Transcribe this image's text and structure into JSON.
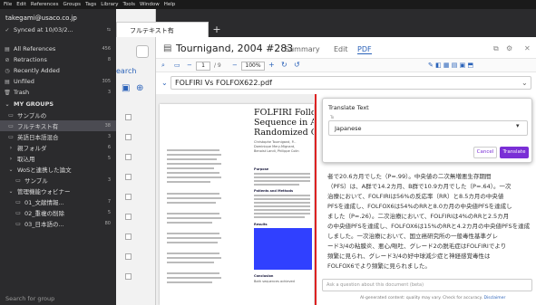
{
  "menubar": [
    "File",
    "Edit",
    "References",
    "Groups",
    "Tags",
    "Library",
    "Tools",
    "Window",
    "Help"
  ],
  "sidebar": {
    "account": "takegami@usaco.co.jp",
    "synced": "Synced at 10/03/2...",
    "items": [
      {
        "label": "All References",
        "count": "456",
        "icon": "library-icon"
      },
      {
        "label": "Retractions",
        "count": "8",
        "icon": "retractions-icon"
      },
      {
        "label": "Recently Added",
        "count": "",
        "icon": "clock-icon"
      },
      {
        "label": "Unfiled",
        "count": "305",
        "icon": "unfiled-icon"
      },
      {
        "label": "Trash",
        "count": "3",
        "icon": "trash-icon"
      }
    ],
    "groups_header": "MY GROUPS",
    "groups": [
      {
        "label": "サンプルの",
        "count": "",
        "indent": 1
      },
      {
        "label": "フルテキスト有",
        "count": "38",
        "indent": 1,
        "selected": true
      },
      {
        "label": "英語日本語混合",
        "count": "3",
        "indent": 1
      },
      {
        "label": "親フォルダ",
        "count": "6",
        "indent": 1
      },
      {
        "label": "取込用",
        "count": "5",
        "indent": 1
      },
      {
        "label": "WoSと連携した論文",
        "count": "",
        "indent": 1
      },
      {
        "label": "サンプル",
        "count": "3",
        "indent": 2
      },
      {
        "label": "管理機能ウォビナー",
        "count": "",
        "indent": 1
      },
      {
        "label": "01_文献情報...",
        "count": "7",
        "indent": 2
      },
      {
        "label": "02_重複の削除",
        "count": "5",
        "indent": 2
      },
      {
        "label": "03_日本語の...",
        "count": "80",
        "indent": 2
      }
    ],
    "search_placeholder": "Search for group"
  },
  "tab": {
    "title": "フルテキスト有",
    "plus": "+"
  },
  "middle": {
    "search_label": "earch"
  },
  "reference": {
    "title": "Tournigand, 2004 #283",
    "tabs": [
      "Summary",
      "Edit",
      "PDF"
    ],
    "active_tab": "PDF"
  },
  "toolbar": {
    "page": "1",
    "pages": "/ 9",
    "zoom": "100%"
  },
  "file": {
    "name": "FOLFIRI Vs FOLFOX622.pdf"
  },
  "pdf": {
    "heading": [
      "FOLFIRI Follo",
      "Sequence in Ac",
      "Randomized G"
    ],
    "authors": [
      "Christophe Tournigand, P...",
      "Dominique Mery-Mignard,",
      "Benoist Landi, Philippe Colin"
    ],
    "sections": [
      "Purpose",
      "Patients and Methods",
      "Results",
      "Conclusion"
    ],
    "conclusion_text": "Both sequences achieved"
  },
  "translate": {
    "title": "Translate Text",
    "to_label": "To",
    "language": "Japanese",
    "cancel": "Cancel",
    "submit": "Translate"
  },
  "translated_text": [
    "者で20.6カ月でした（P=.99）。中央値の二次無増悪生存期間",
    "（PFS）は、A群で14.2カ月、B群で10.9カ月でした（P=.64）。一次",
    "治療において、FOLFIRIは56%の反応率（RR）と8.5カ月の中央値",
    "PFSを達成し、FOLFOX6は54%のRRと8.0カ月の中央値PFSを達成し",
    "ました（P=.26）。二次治療において、FOLFIRIは4%のRRと2.5カ月",
    "の中央値PFSを達成し、FOLFOX6は15%のRRと4.2カ月の中央値PFSを達成",
    "しました。一次治療において、国立癌研究所の一般毒性基準グレ",
    "ード3/4の粘膜炎、悪心/嘔吐、グレード2の脱毛症はFOLFIRIでより",
    "頻繁に見られ、グレード3/4の好中球減少症と神経感覚毒性は",
    "FOLFOX6でより頻繁に見られました。"
  ],
  "ask": {
    "placeholder": "Ask a question about this document (beta)"
  },
  "disclaimer": {
    "text": "AI-generated content: quality may vary. Check for accuracy.",
    "link": "Disclaimer"
  },
  "colors": {
    "accent": "#7a2fd6",
    "highlight": "#3040ff",
    "sidebar_bg": "#2b2b2d",
    "link": "#2a62b9"
  }
}
